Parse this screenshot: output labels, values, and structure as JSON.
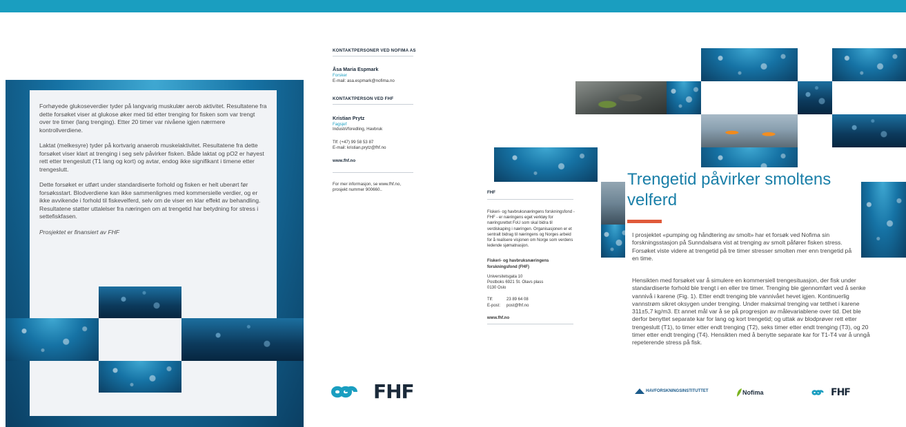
{
  "page1": {
    "paragraphs": [
      "Forhøyede glukoseverdier tyder på langvarig muskulær aerob aktivitet. Resultatene fra dette forsøket viser at glukose øker med tid etter trenging for fisken som var trengt over tre timer (lang trenging). Etter 20 timer var nivåene igjen nærmere kontrollverdiene.",
      "Laktat (melkesyre) tyder på kortvarig anaerob muskelaktivitet. Resultatene fra dette forsøket viser klart at trenging i seg selv påvirker fisken. Både laktat og pO2 er høyest rett etter trengeslutt (T1 lang og kort) og avtar, endog ikke signifikant i timene etter trengeslutt.",
      "Dette forsøket er utført under standardiserte forhold og fisken er helt uberørt før forsøksstart. Blodverdiene kan ikke sammenlignes med kommersielle verdier, og er ikke avvikende i forhold til fiskevelferd, selv om de viser en klar effekt av behandling. Resultatene støtter uttalelser fra næringen om at trengetid har betydning for stress i settefiskfasen."
    ],
    "financed": "Prosjektet er finansiert av FHF"
  },
  "page2": {
    "contacts_nofima_heading": "KONTAKTPERSONER VED NOFIMA AS",
    "nofima_name": "Åsa Maria Espmark",
    "nofima_role": "Forsker",
    "nofima_email": "E-mail: asa.espmark@nofima.no",
    "contacts_fhf_heading": "KONTAKTPERSON VED FHF",
    "fhf_name": "Kristian Prytz",
    "fhf_role": "Fagsjef",
    "fhf_area": "Industri/foredling, Havbruk",
    "fhf_phone": "Tlf: (+47) 99 58 53 87",
    "fhf_email": "E-mail: kristian.prytz@fhf.no",
    "web": "www.fhf.no",
    "more_info_1": "For mer informasjon, se www.fhf.no,",
    "more_info_2": "prosjekt nummer 900660..",
    "logo_text": "FHF"
  },
  "page3": {
    "side_heading": "FHF",
    "side_about": "Fiskeri- og havbruksnæringens forskningsfond - FHF - er næringens eget verktøy for næringsrettet FoU som skal bidra til verdiskaping i næringen. Organisasjonen er et sentralt bidrag til næringens og Norges arbeid for å realisere visjonen om Norge som verdens ledende sjømatnasjon.",
    "side_org": "Fiskeri- og havbruksnæringens forskningsfond (FHF)",
    "side_address_1": "Universitetsgata 10",
    "side_address_2": "Postboks 6921 St. Olavs plass",
    "side_address_3": "0130 Oslo",
    "side_tlf_label": "Tlf:",
    "side_tlf": "23 89 64 08",
    "side_epost_label": "E-post:",
    "side_epost": "post@fhf.no",
    "side_web": "www.fhf.no",
    "title": "Trengetid påvirker smoltens velferd",
    "intro": "I prosjektet «pumping og håndtering av smolt» har et forsøk ved Nofima sin forskningsstasjon på Sunndalsøra vist at trenging av smolt påfører fisken stress. Forsøket viste videre at trengetid på tre timer stresser smolten mer enn trengetid på en time.",
    "body": "Hensikten med forsøket var å simulere en kommersiell trengesituasjon, der fisk under standardiserte forhold ble trengt i en eller tre timer. Trenging ble gjennomført ved å senke vannivå i karene (Fig. 1). Etter endt trenging ble vannivået hevet igjen. Kontinuerlig vannstrøm sikret oksygen under trenging. Under maksimal trenging var tetthet i karene 311±5,7 kg/m3. Et annet mål var å se på progresjon av måleva­riablene over tid. Det ble derfor benyttet separate kar for lang og kort trengetid; og uttak av blodprøver rett etter trengeslutt (T1), to timer etter endt trenging (T2), seks timer etter endt trenging (T3), og 20 timer etter endt trenging (T4). Hensikten med å benytte separate kar for T1-T4 var å unngå repeterende stress på fisk.",
    "logo_havforsk": "HAVFORSKNINGSINSTITUTTET",
    "logo_nofima": "Nofima",
    "logo_fhf": "FHF"
  },
  "colors": {
    "brand_blue": "#1a9ec0",
    "title_blue": "#1a7fa8",
    "accent_red": "#e05a3a",
    "navy": "#1b2a3a"
  }
}
